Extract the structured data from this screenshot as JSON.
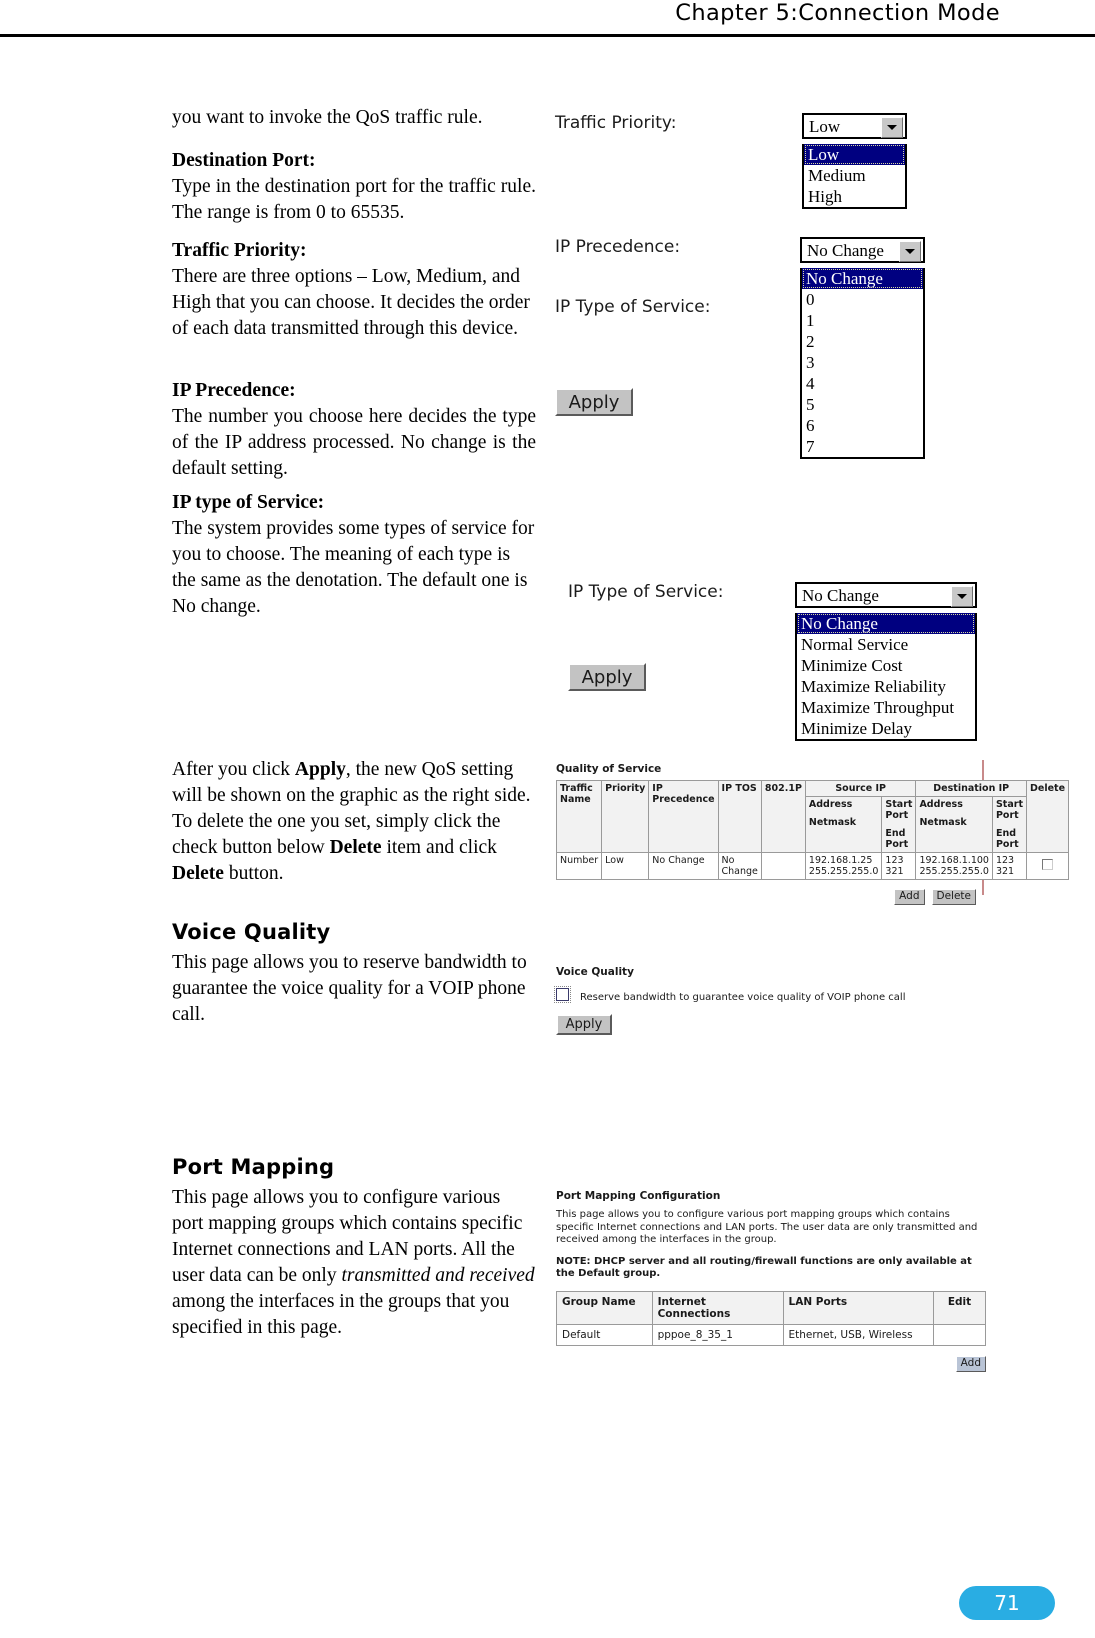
{
  "header": {
    "chapter": "Chapter 5:Connection Mode"
  },
  "page_number": "71",
  "left_column": {
    "intro_line": "you want to invoke the QoS traffic rule.",
    "destination_port": {
      "label": "Destination Port:",
      "body": "Type in the destination port for the traffic rule. The range is from 0 to 65535."
    },
    "traffic_priority": {
      "label": "Traffic Priority:",
      "body": "There are three options – Low, Medium, and High that you can choose. It decides the order of each data transmitted through this device."
    },
    "ip_precedence": {
      "label": "IP Precedence:",
      "body": "The number you choose here decides the type of the IP address processed. No change is the default setting."
    },
    "ip_type_of_service": {
      "label": "IP type of Service",
      "label_colon": ":",
      "body": "The system provides some types of service for you to choose. The meaning of each type is the same as the denotation. The default one is No change."
    },
    "after_apply": {
      "t1": "After you click ",
      "b1": "Apply",
      "t2": ", the new QoS setting will be shown on the graphic as the right side. To delete the one you set, simply click the check button below ",
      "b2": "Delete",
      "t3": " item and click ",
      "b3": "Delete",
      "t4": " button."
    },
    "voice_quality": {
      "heading": "Voice Quality",
      "body": "This page allows you to reserve bandwidth to guarantee the voice quality for a VOIP phone call."
    },
    "port_mapping": {
      "heading": "Port Mapping",
      "t1": "This page allows you to configure various port mapping groups which contains specific Internet connections and LAN ports. All the user data can be only ",
      "i1": "transmitted and received",
      "t2": " among the interfaces in the groups that you specified in this page."
    }
  },
  "screenshots": {
    "traffic_priority_field": {
      "label": "Traffic Priority:",
      "selected": "Low",
      "options": [
        "Low",
        "Medium",
        "High"
      ]
    },
    "ip_precedence_field": {
      "label": "IP Precedence:",
      "selected": "No Change",
      "options": [
        "No Change",
        "0",
        "1",
        "2",
        "3",
        "4",
        "5",
        "6",
        "7"
      ]
    },
    "ip_tos_label_upper": "IP Type of Service:",
    "apply_button_upper": "Apply",
    "ip_tos_field": {
      "label": "IP Type of Service:",
      "selected": "No Change",
      "options": [
        "No Change",
        "Normal Service",
        "Minimize Cost",
        "Maximize Reliability",
        "Maximize Throughput",
        "Minimize Delay"
      ]
    },
    "apply_button_lower": "Apply",
    "qos_table": {
      "title": "Quality of Service",
      "group_headers": {
        "traffic_name": "Traffic Name",
        "priority": "Priority",
        "ip_precedence": "IP Precedence",
        "ip_tos": "IP TOS",
        "dot1p": "802.1P",
        "source_ip": "Source IP",
        "destination_ip": "Destination IP",
        "delete": "Delete"
      },
      "sub_headers": {
        "address": "Address",
        "netmask": "Netmask",
        "start_port": "Start Port",
        "end_port": "End Port"
      },
      "row": {
        "traffic_name": "Number",
        "priority": "Low",
        "ip_precedence": "No Change",
        "ip_tos": "No Change",
        "dot1p": "",
        "src_address": "192.168.1.25",
        "src_netmask": "255.255.255.0",
        "src_start_port": "123",
        "src_end_port": "321",
        "dst_address": "192.168.1.100",
        "dst_netmask": "255.255.255.0",
        "dst_start_port": "123",
        "dst_end_port": "321"
      },
      "buttons": {
        "add": "Add",
        "delete": "Delete"
      }
    },
    "voice_quality_panel": {
      "title": "Voice Quality",
      "checkbox_label": "Reserve bandwidth to guarantee voice quality of VOIP phone call",
      "apply": "Apply"
    },
    "port_mapping_panel": {
      "title": "Port Mapping Configuration",
      "description": "This page allows you to configure various port mapping groups which contains specific Internet connections and LAN ports. The user data are only transmitted and received among the interfaces in the group.",
      "note_prefix": "NOTE: DHCP server and all ",
      "note_bold1": "routing/firewall functions",
      "note_mid": " are ",
      "note_bold2": "only",
      "note_suffix": " available at the Default group.",
      "table": {
        "headers": [
          "Group Name",
          "Internet Connections",
          "LAN Ports",
          "Edit"
        ],
        "rows": [
          [
            "Default",
            "pppoe_8_35_1",
            "Ethernet, USB, Wireless",
            ""
          ]
        ]
      },
      "add_button": "Add"
    }
  },
  "colors": {
    "page_badge": "#29ade3",
    "select_highlight": "#000080",
    "button_face": "#c3c3c3"
  }
}
